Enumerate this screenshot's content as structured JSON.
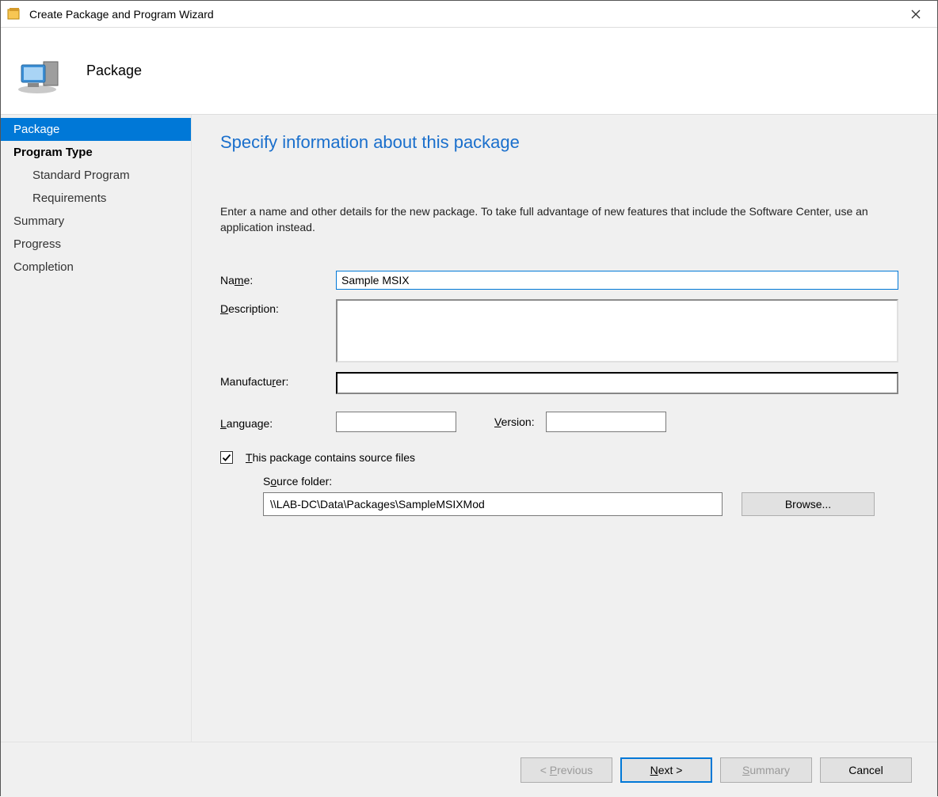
{
  "window": {
    "title": "Create Package and Program Wizard",
    "header_title": "Package"
  },
  "sidebar": {
    "items": [
      {
        "label": "Package",
        "selected": true
      },
      {
        "label": "Program Type",
        "bold": true
      },
      {
        "label": "Standard Program",
        "sub": true
      },
      {
        "label": "Requirements",
        "sub": true
      },
      {
        "label": "Summary"
      },
      {
        "label": "Progress"
      },
      {
        "label": "Completion"
      }
    ]
  },
  "main": {
    "heading": "Specify information about this package",
    "instruction": "Enter a name and other details for the new package. To take full advantage of new features that include the Software Center, use an application instead.",
    "labels": {
      "name": "Name:",
      "name_accel": "m",
      "description": "Description:",
      "description_accel": "D",
      "manufacturer": "Manufacturer:",
      "manufacturer_accel": "r",
      "language": "Language:",
      "language_accel": "L",
      "version": "Version:",
      "version_accel": "V",
      "source_checkbox": "This package contains source files",
      "source_checkbox_accel": "T",
      "source_folder": "Source folder:",
      "source_folder_accel": "o"
    },
    "values": {
      "name": "Sample MSIX",
      "description": "",
      "manufacturer": "",
      "language": "",
      "version": "",
      "source_checked": true,
      "source_folder": "\\\\LAB-DC\\Data\\Packages\\SampleMSIXMod"
    },
    "browse_button": "Browse..."
  },
  "footer": {
    "previous": "Previous",
    "previous_accel": "P",
    "next": "Next >",
    "next_accel": "N",
    "summary": "Summary",
    "summary_accel": "S",
    "cancel": "Cancel"
  }
}
